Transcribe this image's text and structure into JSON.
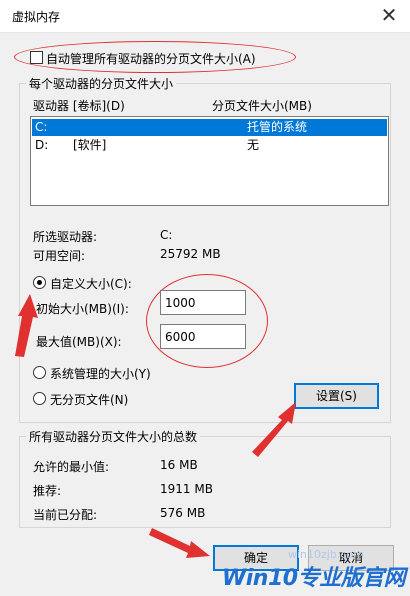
{
  "window": {
    "title": "虚拟内存",
    "close_glyph": "✕"
  },
  "auto_manage": {
    "label": "自动管理所有驱动器的分页文件大小(A)",
    "checked": false
  },
  "drive_group": {
    "legend": "每个驱动器的分页文件大小",
    "col_drive": "驱动器 [卷标](D)",
    "col_size": "分页文件大小(MB)",
    "rows": [
      {
        "drive": "C:",
        "label": "",
        "size": "托管的系统",
        "selected": true
      },
      {
        "drive": "D:",
        "label": "[软件]",
        "size": "无",
        "selected": false
      }
    ],
    "selected_drive_label": "所选驱动器:",
    "selected_drive_value": "C:",
    "free_space_label": "可用空间:",
    "free_space_value": "25792 MB",
    "custom_size_label": "自定义大小(C):",
    "initial_label": "初始大小(MB)(I):",
    "initial_value": "1000",
    "max_label": "最大值(MB)(X):",
    "max_value": "6000",
    "system_managed_label": "系统管理的大小(Y)",
    "no_paging_label": "无分页文件(N)",
    "set_button": "设置(S)"
  },
  "totals_group": {
    "legend": "所有驱动器分页文件大小的总数",
    "min_label": "允许的最小值:",
    "min_value": "16 MB",
    "recommended_label": "推荐:",
    "recommended_value": "1911 MB",
    "current_label": "当前已分配:",
    "current_value": "576 MB"
  },
  "buttons": {
    "ok": "确定",
    "cancel": "取消"
  },
  "watermark": {
    "main": "Win10专业版官网",
    "url": "win10zjb.com"
  },
  "colors": {
    "selection": "#0078d7",
    "annotation": "#e03030",
    "watermark": "#1f6fd1"
  }
}
